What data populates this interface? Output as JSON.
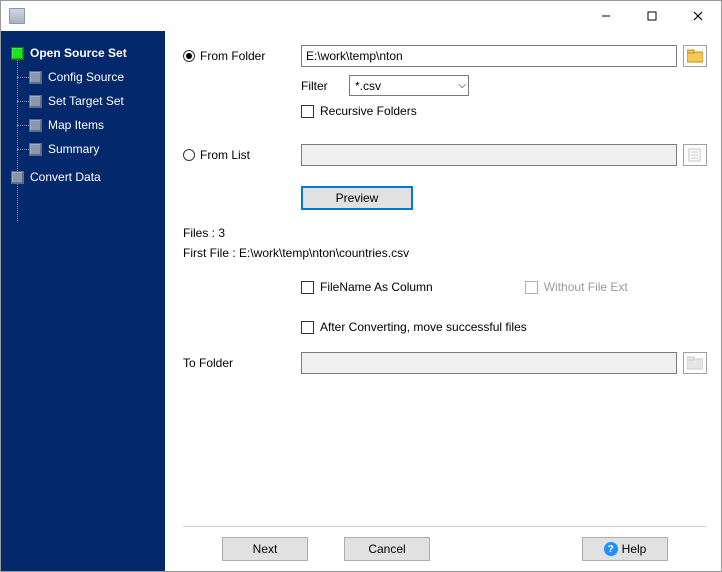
{
  "sidebar": {
    "items": [
      {
        "label": "Open Source Set",
        "active": true,
        "child": false
      },
      {
        "label": "Config Source",
        "active": false,
        "child": true
      },
      {
        "label": "Set Target Set",
        "active": false,
        "child": true
      },
      {
        "label": "Map Items",
        "active": false,
        "child": true
      },
      {
        "label": "Summary",
        "active": false,
        "child": true
      },
      {
        "label": "Convert Data",
        "active": false,
        "child": false
      }
    ]
  },
  "form": {
    "from_folder_label": "From Folder",
    "from_folder_value": "E:\\work\\temp\\nton",
    "filter_label": "Filter",
    "filter_value": "*.csv",
    "recursive_label": "Recursive Folders",
    "from_list_label": "From List",
    "from_list_value": "",
    "preview_label": "Preview",
    "files_count_label": "Files : 3",
    "first_file_label": "First File : E:\\work\\temp\\nton\\countries.csv",
    "filename_col_label": "FileName As Column",
    "without_ext_label": "Without File Ext",
    "after_convert_label": "After Converting, move successful files",
    "to_folder_label": "To Folder",
    "to_folder_value": ""
  },
  "buttons": {
    "next": "Next",
    "cancel": "Cancel",
    "help": "Help"
  }
}
